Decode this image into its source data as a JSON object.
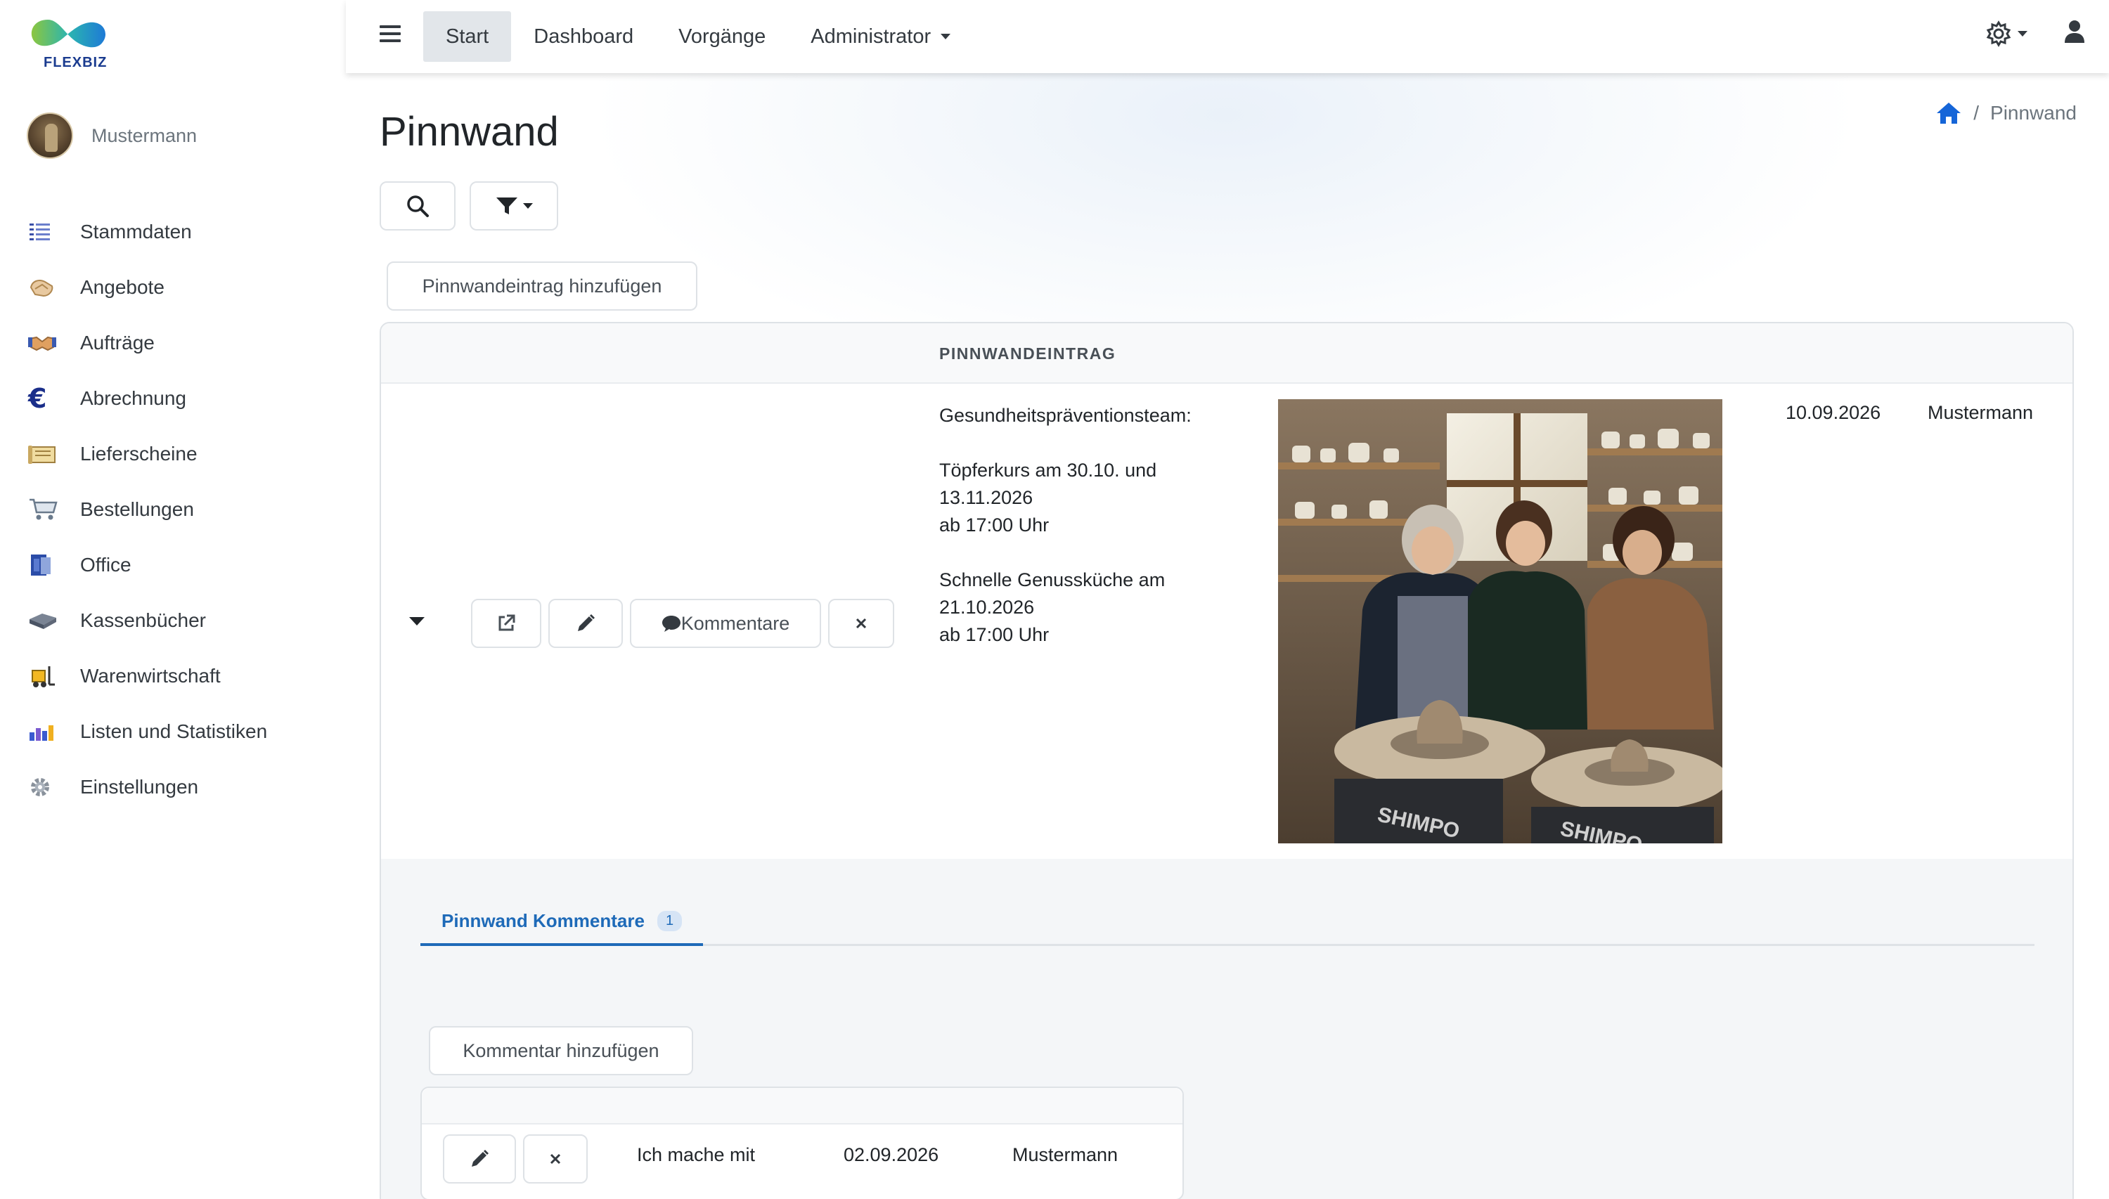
{
  "app": {
    "logo_text": "FLEXBIZ",
    "user_name": "Mustermann"
  },
  "sidebar": {
    "items": [
      {
        "label": "Stammdaten",
        "icon": "list-icon"
      },
      {
        "label": "Angebote",
        "icon": "handshake-offer-icon"
      },
      {
        "label": "Aufträge",
        "icon": "handshake-icon"
      },
      {
        "label": "Abrechnung",
        "icon": "euro-icon"
      },
      {
        "label": "Lieferscheine",
        "icon": "delivery-note-icon"
      },
      {
        "label": "Bestellungen",
        "icon": "cart-icon"
      },
      {
        "label": "Office",
        "icon": "office-icon"
      },
      {
        "label": "Kassenbücher",
        "icon": "cashbook-icon"
      },
      {
        "label": "Warenwirtschaft",
        "icon": "forklift-icon"
      },
      {
        "label": "Listen und Statistiken",
        "icon": "bar-chart-icon"
      },
      {
        "label": "Einstellungen",
        "icon": "gear-icon"
      }
    ]
  },
  "topbar": {
    "menu": [
      {
        "label": "Start",
        "active": true
      },
      {
        "label": "Dashboard",
        "active": false
      },
      {
        "label": "Vorgänge",
        "active": false
      },
      {
        "label": "Administrator",
        "active": false,
        "dropdown": true
      }
    ]
  },
  "page": {
    "title": "Pinnwand",
    "breadcrumb_current": "Pinnwand",
    "add_entry_label": "Pinnwandeintrag hinzufügen"
  },
  "table": {
    "column_header": "PINNWANDEINTRAG",
    "comments_button": "Kommentare",
    "entry": {
      "lines": [
        "Gesundheitspräventionsteam:",
        "Töpferkurs am 30.10. und 13.11.2026",
        "ab 17:00 Uhr",
        "Schnelle Genussküche am 21.10.2026",
        "ab 17:00 Uhr"
      ],
      "date": "10.09.2026",
      "author": "Mustermann"
    }
  },
  "comments": {
    "tab_label": "Pinnwand Kommentare",
    "tab_count": "1",
    "add_label": "Kommentar hinzufügen",
    "rows": [
      {
        "text": "Ich mache mit",
        "date": "02.09.2026",
        "author": "Mustermann"
      }
    ]
  },
  "colors": {
    "accent": "#1e6ab8",
    "home_icon": "#1565d8"
  }
}
